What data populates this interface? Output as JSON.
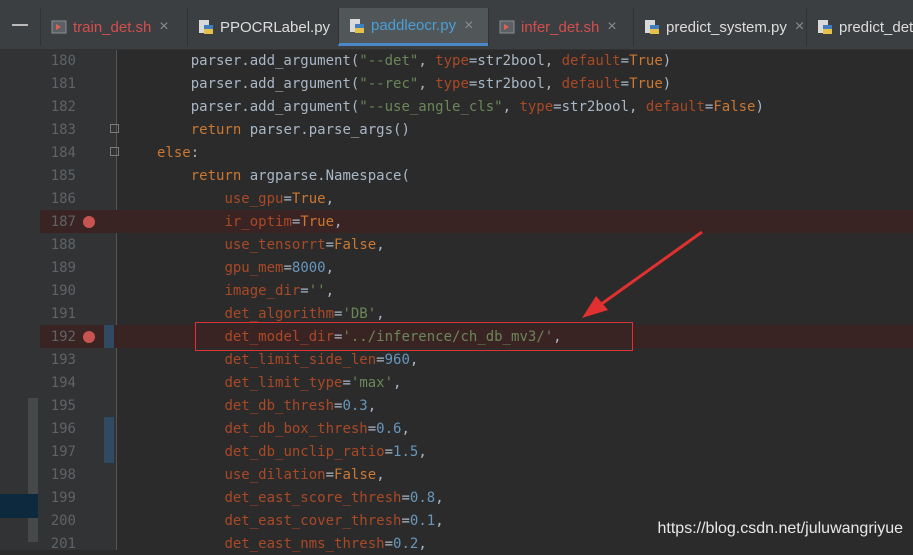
{
  "tabs": [
    {
      "label": "train_det.sh",
      "icon": "shell-script-icon",
      "color": "#d44e4e",
      "active": false
    },
    {
      "label": "PPOCRLabel.py",
      "icon": "python-file-icon",
      "color": "#dddddd",
      "active": false
    },
    {
      "label": "paddleocr.py",
      "icon": "python-file-icon",
      "color": "#4a9fd8",
      "active": true
    },
    {
      "label": "infer_det.sh",
      "icon": "shell-script-icon",
      "color": "#d44e4e",
      "active": false
    },
    {
      "label": "predict_system.py",
      "icon": "python-file-icon",
      "color": "#dddddd",
      "active": false
    },
    {
      "label": "predict_det",
      "icon": "python-file-icon",
      "color": "#dddddd",
      "active": false
    }
  ],
  "tab_close_glyph": "×",
  "lines": [
    {
      "n": "180",
      "parts": [
        [
          "    parser.add_argument(",
          "t"
        ],
        [
          "\"--det\"",
          "s"
        ],
        [
          ", ",
          "t"
        ],
        [
          "type",
          "k"
        ],
        [
          "=str2bool, ",
          "t"
        ],
        [
          "default",
          "k"
        ],
        [
          "=",
          "t"
        ],
        [
          "True",
          "kw"
        ],
        [
          ")",
          "t"
        ]
      ]
    },
    {
      "n": "181",
      "parts": [
        [
          "    parser.add_argument(",
          "t"
        ],
        [
          "\"--rec\"",
          "s"
        ],
        [
          ", ",
          "t"
        ],
        [
          "type",
          "k"
        ],
        [
          "=str2bool, ",
          "t"
        ],
        [
          "default",
          "k"
        ],
        [
          "=",
          "t"
        ],
        [
          "True",
          "kw"
        ],
        [
          ")",
          "t"
        ]
      ]
    },
    {
      "n": "182",
      "parts": [
        [
          "    parser.add_argument(",
          "t"
        ],
        [
          "\"--use_angle_cls\"",
          "s"
        ],
        [
          ", ",
          "t"
        ],
        [
          "type",
          "k"
        ],
        [
          "=str2bool, ",
          "t"
        ],
        [
          "default",
          "k"
        ],
        [
          "=",
          "t"
        ],
        [
          "False",
          "kw"
        ],
        [
          ")",
          "t"
        ]
      ]
    },
    {
      "n": "183",
      "parts": [
        [
          "    ",
          "t"
        ],
        [
          "return",
          "kw"
        ],
        [
          " parser.parse_args()",
          "t"
        ]
      ]
    },
    {
      "n": "184",
      "parts": [
        [
          "else",
          "kw"
        ],
        [
          ":",
          "t"
        ]
      ]
    },
    {
      "n": "185",
      "parts": [
        [
          "    ",
          "t"
        ],
        [
          "return",
          "kw"
        ],
        [
          " argparse.Namespace(",
          "t"
        ]
      ]
    },
    {
      "n": "186",
      "parts": [
        [
          "        ",
          "t"
        ],
        [
          "use_gpu",
          "k"
        ],
        [
          "=",
          "t"
        ],
        [
          "True",
          "kw"
        ],
        [
          ",",
          "t"
        ]
      ]
    },
    {
      "n": "187",
      "parts": [
        [
          "        ",
          "t"
        ],
        [
          "ir_optim",
          "k"
        ],
        [
          "=",
          "t"
        ],
        [
          "True",
          "kw"
        ],
        [
          ",",
          "t"
        ]
      ],
      "breakpoint": true
    },
    {
      "n": "188",
      "parts": [
        [
          "        ",
          "t"
        ],
        [
          "use_tensorrt",
          "k"
        ],
        [
          "=",
          "t"
        ],
        [
          "False",
          "kw"
        ],
        [
          ",",
          "t"
        ]
      ]
    },
    {
      "n": "189",
      "parts": [
        [
          "        ",
          "t"
        ],
        [
          "gpu_mem",
          "k"
        ],
        [
          "=",
          "t"
        ],
        [
          "8000",
          "n"
        ],
        [
          ",",
          "t"
        ]
      ]
    },
    {
      "n": "190",
      "parts": [
        [
          "        ",
          "t"
        ],
        [
          "image_dir",
          "k"
        ],
        [
          "=",
          "t"
        ],
        [
          "''",
          "s"
        ],
        [
          ",",
          "t"
        ]
      ]
    },
    {
      "n": "191",
      "parts": [
        [
          "        ",
          "t"
        ],
        [
          "det_algorithm",
          "k"
        ],
        [
          "=",
          "t"
        ],
        [
          "'DB'",
          "s"
        ],
        [
          ",",
          "t"
        ]
      ]
    },
    {
      "n": "192",
      "parts": [
        [
          "        ",
          "t"
        ],
        [
          "det_model_dir",
          "k"
        ],
        [
          "=",
          "t"
        ],
        [
          "'../inference/ch_db_mv3/'",
          "s"
        ],
        [
          ",",
          "t"
        ]
      ],
      "breakpoint": true
    },
    {
      "n": "193",
      "parts": [
        [
          "        ",
          "t"
        ],
        [
          "det_limit_side_len",
          "k"
        ],
        [
          "=",
          "t"
        ],
        [
          "960",
          "n"
        ],
        [
          ",",
          "t"
        ]
      ]
    },
    {
      "n": "194",
      "parts": [
        [
          "        ",
          "t"
        ],
        [
          "det_limit_type",
          "k"
        ],
        [
          "=",
          "t"
        ],
        [
          "'max'",
          "s"
        ],
        [
          ",",
          "t"
        ]
      ]
    },
    {
      "n": "195",
      "parts": [
        [
          "        ",
          "t"
        ],
        [
          "det_db_thresh",
          "k"
        ],
        [
          "=",
          "t"
        ],
        [
          "0.3",
          "n"
        ],
        [
          ",",
          "t"
        ]
      ]
    },
    {
      "n": "196",
      "parts": [
        [
          "        ",
          "t"
        ],
        [
          "det_db_box_thresh",
          "k"
        ],
        [
          "=",
          "t"
        ],
        [
          "0.6",
          "n"
        ],
        [
          ",",
          "t"
        ]
      ]
    },
    {
      "n": "197",
      "parts": [
        [
          "        ",
          "t"
        ],
        [
          "det_db_unclip_ratio",
          "k"
        ],
        [
          "=",
          "t"
        ],
        [
          "1.5",
          "n"
        ],
        [
          ",",
          "t"
        ]
      ]
    },
    {
      "n": "198",
      "parts": [
        [
          "        ",
          "t"
        ],
        [
          "use_dilation",
          "k"
        ],
        [
          "=",
          "t"
        ],
        [
          "False",
          "kw"
        ],
        [
          ",",
          "t"
        ]
      ]
    },
    {
      "n": "199",
      "parts": [
        [
          "        ",
          "t"
        ],
        [
          "det_east_score_thresh",
          "k"
        ],
        [
          "=",
          "t"
        ],
        [
          "0.8",
          "n"
        ],
        [
          ",",
          "t"
        ]
      ]
    },
    {
      "n": "200",
      "parts": [
        [
          "        ",
          "t"
        ],
        [
          "det_east_cover_thresh",
          "k"
        ],
        [
          "=",
          "t"
        ],
        [
          "0.1",
          "n"
        ],
        [
          ",",
          "t"
        ]
      ]
    },
    {
      "n": "201",
      "parts": [
        [
          "        ",
          "t"
        ],
        [
          "det_east_nms_thresh",
          "k"
        ],
        [
          "=",
          "t"
        ],
        [
          "0.2",
          "n"
        ],
        [
          ",",
          "t"
        ]
      ]
    }
  ],
  "annotation": {
    "color": "#e03030"
  },
  "watermark": "https://blog.csdn.net/juluwangriyue",
  "colors": {
    "background": "#2b2b2b",
    "keyword": "#cc7832",
    "string": "#6a8759",
    "number": "#6897bb",
    "kwarg": "#aa4926",
    "text": "#a9b7c6",
    "breakpoint": "#c75450",
    "active_tab_underline": "#4a88c7"
  }
}
